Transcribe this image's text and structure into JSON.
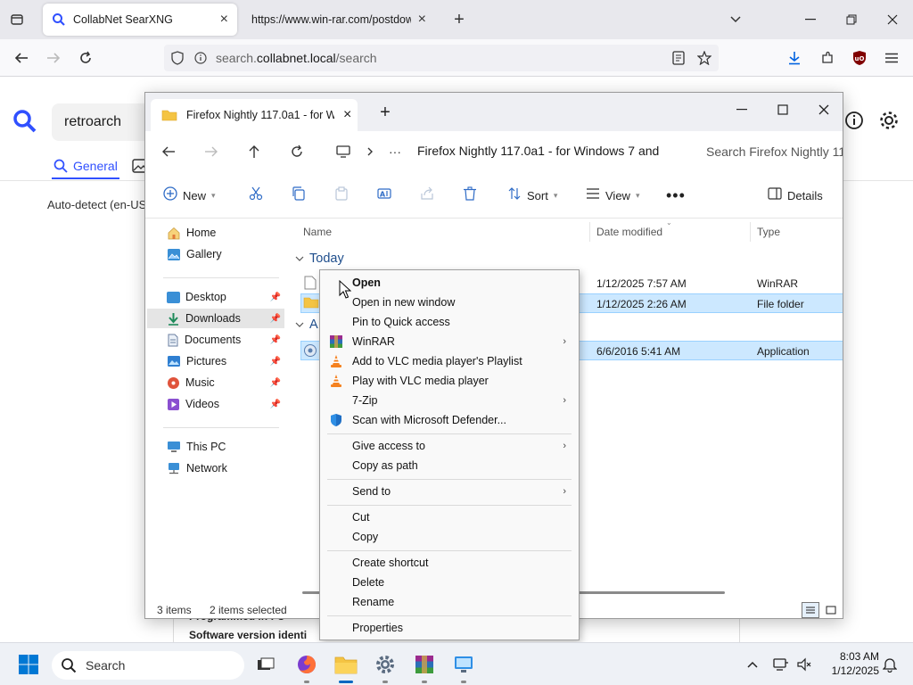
{
  "browser": {
    "tabs": [
      {
        "title": "CollabNet SearXNG"
      },
      {
        "title": "https://www.win-rar.com/postdow"
      }
    ],
    "url": {
      "prefix": "search.",
      "host": "collabnet.local",
      "path": "/search"
    }
  },
  "searx": {
    "query": "retroarch",
    "tab_general": "General",
    "autodetect": "Auto-detect (en-US",
    "result_line1": "Programmed in : C",
    "result_line2": "Software version identi"
  },
  "explorer": {
    "tab_title": "Firefox Nightly 117.0a1 - for Wi",
    "path": "Firefox Nightly 117.0a1 - for Windows 7 and",
    "search_placeholder": "Search Firefox Nightly 11",
    "toolbar": {
      "new": "New",
      "sort": "Sort",
      "view": "View",
      "details": "Details"
    },
    "nav": {
      "top": [
        {
          "label": "Home"
        },
        {
          "label": "Gallery"
        }
      ],
      "pinned": [
        {
          "label": "Desktop",
          "color": "#3a8fd6"
        },
        {
          "label": "Downloads",
          "color": "#1e8a5a"
        },
        {
          "label": "Documents",
          "color": "#6b7fa0"
        },
        {
          "label": "Pictures",
          "color": "#2f7fd1"
        },
        {
          "label": "Music",
          "color": "#e0533b"
        },
        {
          "label": "Videos",
          "color": "#8a4fd0"
        }
      ],
      "bottom": [
        {
          "label": "This PC"
        },
        {
          "label": "Network"
        }
      ]
    },
    "columns": {
      "name": "Name",
      "date": "Date modified",
      "type": "Type"
    },
    "groups": {
      "today": "Today",
      "a": "A"
    },
    "rows": [
      {
        "date": "1/12/2025 7:57 AM",
        "type": "WinRAR"
      },
      {
        "date": "1/12/2025 2:26 AM",
        "type": "File folder"
      },
      {
        "date": "6/6/2016 5:41 AM",
        "type": "Application"
      }
    ],
    "status": {
      "items": "3 items",
      "selected": "2 items selected"
    }
  },
  "context_menu": {
    "open": "Open",
    "open_new_window": "Open in new window",
    "pin_quick": "Pin to Quick access",
    "winrar": "WinRAR",
    "vlc_playlist": "Add to VLC media player's Playlist",
    "vlc_play": "Play with VLC media player",
    "sevenzip": "7-Zip",
    "defender": "Scan with Microsoft Defender...",
    "give_access": "Give access to",
    "copy_path": "Copy as path",
    "send_to": "Send to",
    "cut": "Cut",
    "copy": "Copy",
    "create_shortcut": "Create shortcut",
    "delete": "Delete",
    "rename": "Rename",
    "properties": "Properties"
  },
  "taskbar": {
    "search": "Search",
    "time": "8:03 AM",
    "date": "1/12/2025"
  }
}
